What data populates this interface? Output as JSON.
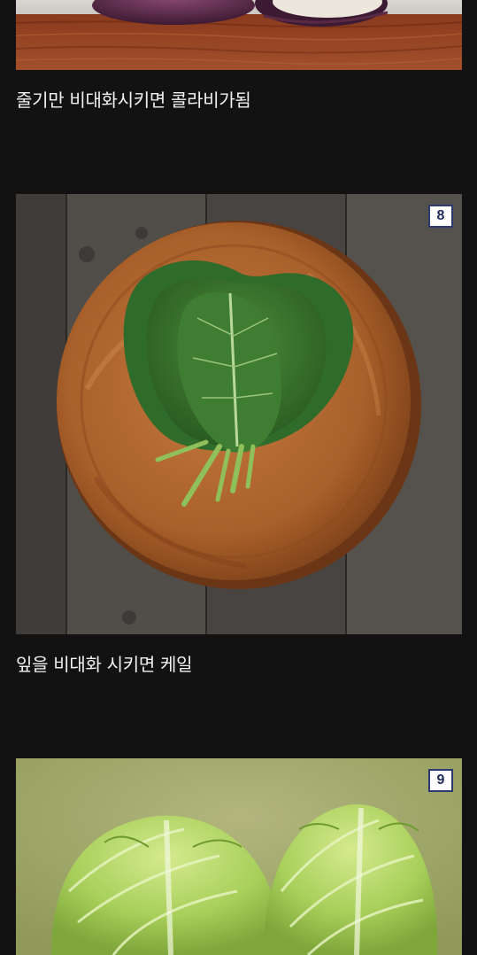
{
  "items": [
    {
      "image": "kohlrabi-photo",
      "caption": "줄기만 비대화시키면 콜라비가됨"
    },
    {
      "image": "kale-leaves-photo",
      "badge": "8",
      "caption": "잎을 비대화 시키면 케일"
    },
    {
      "image": "napa-cabbage-photo",
      "badge": "9"
    }
  ],
  "colors": {
    "background": "#121212",
    "caption_text": "#f2f2f2",
    "badge_border": "#2e3a6e"
  }
}
